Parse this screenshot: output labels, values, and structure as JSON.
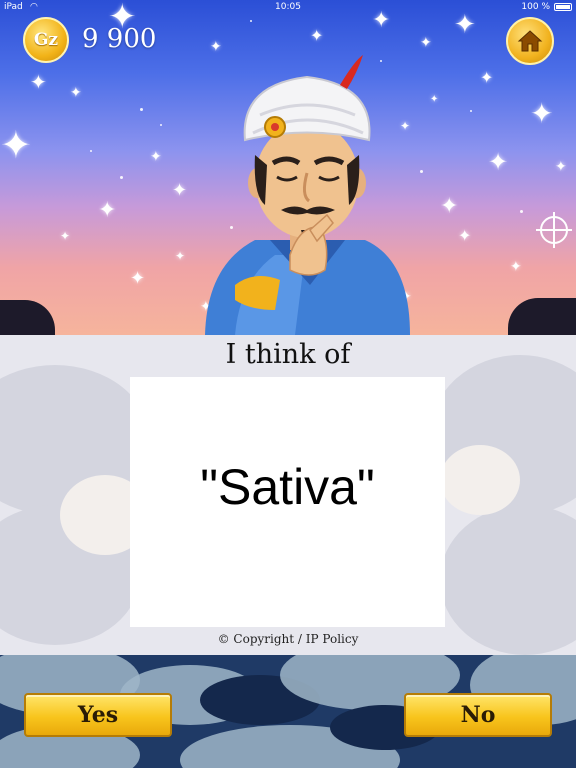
{
  "status_bar": {
    "carrier": "iPad",
    "time": "10:05",
    "battery": "100 %"
  },
  "header": {
    "coin_symbol": "Gz",
    "coins": "9 900",
    "home_icon": "home-icon"
  },
  "result": {
    "heading": "I think of",
    "answer": "\"Sativa\"",
    "copyright": "© Copyright / IP Policy"
  },
  "actions": {
    "yes_label": "Yes",
    "no_label": "No"
  },
  "colors": {
    "button_gold": "#f8c51d",
    "sky_top": "#2b4fd6",
    "sky_bottom": "#f6b49c"
  }
}
